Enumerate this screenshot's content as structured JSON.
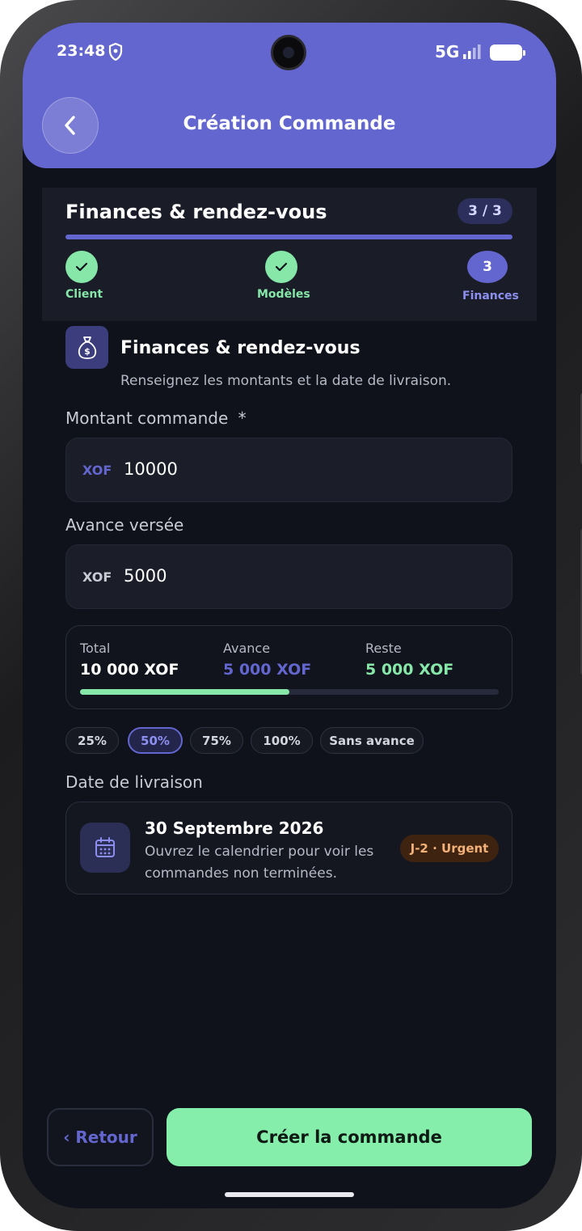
{
  "status": {
    "time": "23:48",
    "network": "5G"
  },
  "header": {
    "title": "Création Commande"
  },
  "stepper": {
    "title": "Finances & rendez-vous",
    "count": "3 / 3",
    "steps": [
      {
        "label": "Client",
        "state": "done"
      },
      {
        "label": "Modèles",
        "state": "done"
      },
      {
        "label": "Finances",
        "number": "3",
        "state": "current"
      }
    ]
  },
  "section": {
    "icon": "money-bag-icon",
    "title": "Finances & rendez-vous",
    "subtitle": "Renseignez les montants et la date de livraison."
  },
  "amount": {
    "label": "Montant commande",
    "required": "*",
    "currency": "XOF",
    "value": "10000",
    "currency_color": "#6466cf"
  },
  "advance": {
    "label": "Avance versée",
    "currency": "XOF",
    "value": "5000",
    "currency_color": "#c8cad4"
  },
  "summary": {
    "total_label": "Total",
    "total_value": "10 000 XOF",
    "advance_label": "Avance",
    "advance_value": "5 000 XOF",
    "rest_label": "Reste",
    "rest_value": "5 000 XOF",
    "progress": 0.5
  },
  "chips": [
    {
      "label": "25%",
      "active": false
    },
    {
      "label": "50%",
      "active": true
    },
    {
      "label": "75%",
      "active": false
    },
    {
      "label": "100%",
      "active": false
    },
    {
      "label": "Sans avance",
      "active": false
    }
  ],
  "delivery": {
    "label": "Date de livraison",
    "date": "30 Septembre 2026",
    "hint": "Ouvrez le calendrier pour voir les commandes non terminées.",
    "badge": "J-2 · Urgent"
  },
  "actions": {
    "back": "‹ Retour",
    "create": "Créer la commande"
  },
  "colors": {
    "accent": "#6466cf",
    "success": "#86e7a9",
    "background": "#0f121a"
  }
}
